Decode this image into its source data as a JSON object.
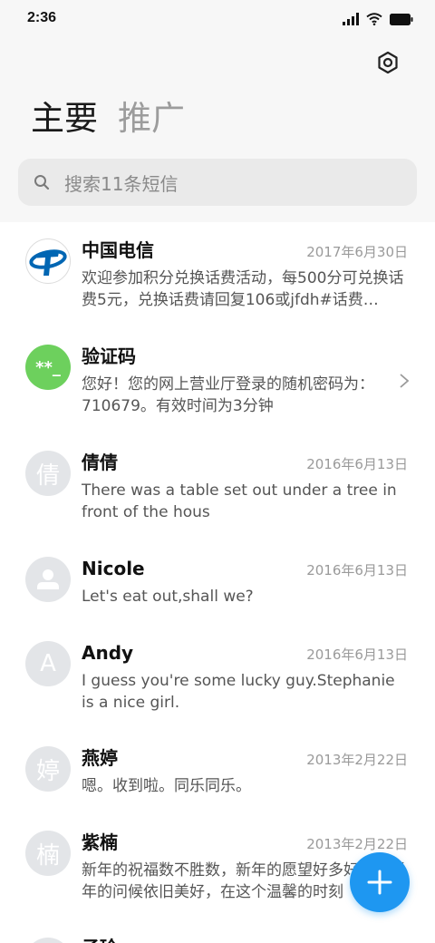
{
  "status": {
    "time": "2:36",
    "icons": [
      "signal-icon",
      "wifi-icon",
      "battery-icon"
    ]
  },
  "header": {
    "settings_icon": "settings-hexagon-icon",
    "tabs": [
      {
        "label": "主要",
        "active": true
      },
      {
        "label": "推广",
        "active": false
      }
    ]
  },
  "search": {
    "placeholder": "搜索11条短信",
    "icon": "search-icon"
  },
  "messages": [
    {
      "name": "中国电信",
      "date": "2017年6月30日",
      "preview": "欢迎参加积分兑换话费活动，每500分可兑换话费5元，兑换话费请回复106或jfdh#话费…",
      "avatar": "china-telecom-logo"
    },
    {
      "name": "验证码",
      "date": "",
      "preview": "您好！您的网上营业厅登录的随机密码为：710679。有效时间为3分钟",
      "avatar_text": "**_",
      "avatar_color": "#6dd05d"
    },
    {
      "name": "倩倩",
      "date": "2016年6月13日",
      "preview": "There was a table set out under a tree in front of the hous",
      "avatar_text": "倩"
    },
    {
      "name": "Nicole",
      "date": "2016年6月13日",
      "preview": "Let's eat out,shall we?",
      "avatar": "person-icon"
    },
    {
      "name": "Andy",
      "date": "2016年6月13日",
      "preview": "I guess you're some lucky guy.Stephanie is a nice girl.",
      "avatar_text": "A"
    },
    {
      "name": "燕婷",
      "date": "2013年2月22日",
      "preview": "嗯。收到啦。同乐同乐。",
      "avatar_text": "婷"
    },
    {
      "name": "紫楠",
      "date": "2013年2月22日",
      "preview": "新年的祝福数不胜数，新年的愿望好多好多，新年的问候依旧美好，在这个温馨的时刻",
      "avatar_text": "楠"
    },
    {
      "name": "子玲",
      "date": "",
      "preview": "",
      "avatar_text": ""
    }
  ],
  "fab": {
    "icon": "plus-icon"
  },
  "colors": {
    "accent": "#1e97f1",
    "verify_green": "#6dd05d",
    "telecom_blue": "#0066b3"
  }
}
